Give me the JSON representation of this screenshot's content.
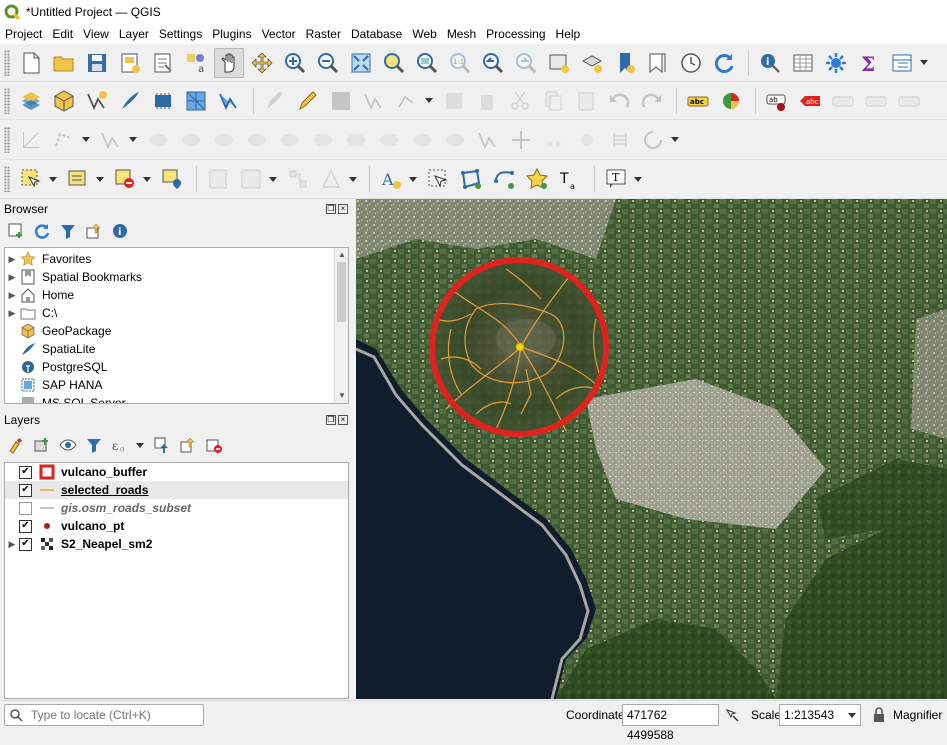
{
  "window": {
    "title": "*Untitled Project — QGIS"
  },
  "menu": [
    "Project",
    "Edit",
    "View",
    "Layer",
    "Settings",
    "Plugins",
    "Vector",
    "Raster",
    "Database",
    "Web",
    "Mesh",
    "Processing",
    "Help"
  ],
  "browser": {
    "title": "Browser",
    "items": [
      {
        "label": "Favorites",
        "icon": "star-icon",
        "expandable": true
      },
      {
        "label": "Spatial Bookmarks",
        "icon": "bookmark-icon",
        "expandable": true
      },
      {
        "label": "Home",
        "icon": "home-icon",
        "expandable": true
      },
      {
        "label": "C:\\",
        "icon": "folder-icon",
        "expandable": true
      },
      {
        "label": "GeoPackage",
        "icon": "geopackage-icon",
        "expandable": false
      },
      {
        "label": "SpatiaLite",
        "icon": "feather-icon",
        "expandable": false
      },
      {
        "label": "PostgreSQL",
        "icon": "elephant-icon",
        "expandable": false
      },
      {
        "label": "SAP HANA",
        "icon": "sap-hana-icon",
        "expandable": false
      },
      {
        "label": "MS SQL Server",
        "icon": "mssql-icon",
        "expandable": false
      }
    ]
  },
  "layers": {
    "title": "Layers",
    "items": [
      {
        "label": "vulcano_buffer",
        "checked": true,
        "style": "normal",
        "symbol": "red-square-icon",
        "expandable": false
      },
      {
        "label": "selected_roads",
        "checked": true,
        "style": "underline",
        "symbol": "orange-line-icon",
        "expandable": false
      },
      {
        "label": "gis.osm_roads_subset",
        "checked": false,
        "style": "italic",
        "symbol": "grey-line-icon",
        "expandable": false
      },
      {
        "label": "vulcano_pt",
        "checked": true,
        "style": "normal",
        "symbol": "red-dot-icon",
        "expandable": false
      },
      {
        "label": "S2_Neapel_sm2",
        "checked": true,
        "style": "normal",
        "symbol": "raster-icon",
        "expandable": true
      }
    ]
  },
  "status": {
    "locator_placeholder": "Type to locate (Ctrl+K)",
    "coordinate_label": "Coordinate",
    "coordinate_value": "471762 4499588",
    "scale_label": "Scale",
    "scale_value": "1:213543",
    "magnifier_label": "Magnifier"
  },
  "colors": {
    "buffer": "#e0221e",
    "roads": "#e8a33a",
    "point": "#f4d40e",
    "accent": "#2e7bd6"
  }
}
